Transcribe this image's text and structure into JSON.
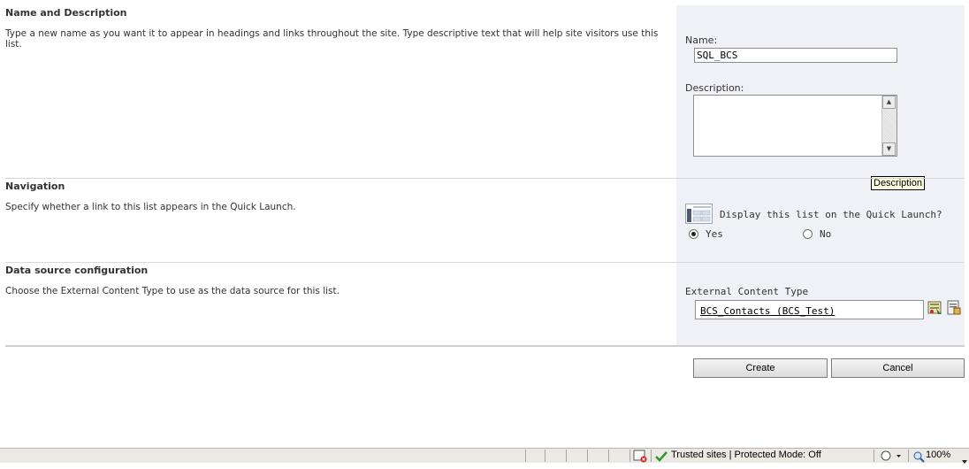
{
  "sections": {
    "name_desc": {
      "title": "Name and Description",
      "description": "Type a new name as you want it to appear in headings and links throughout the site. Type descriptive text that will help site visitors use this list."
    },
    "navigation": {
      "title": "Navigation",
      "description": "Specify whether a link to this list appears in the Quick Launch."
    },
    "data_source": {
      "title": "Data source configuration",
      "description": "Choose the External Content Type to use as the data source for this list."
    }
  },
  "form": {
    "name_label": "Name:",
    "name_value": "SQL_BCS",
    "description_label": "Description:",
    "description_value": "",
    "tooltip": "Description",
    "quick_launch_question": "Display this list on the Quick Launch?",
    "yes_label": "Yes",
    "no_label": "No",
    "yes_selected": true,
    "ect_label": "External Content Type",
    "ect_value": "BCS_Contacts (BCS_Test)"
  },
  "buttons": {
    "create": "Create",
    "cancel": "Cancel"
  },
  "statusbar": {
    "zone": "Trusted sites | Protected Mode: Off",
    "zoom": "100%"
  },
  "icons": {
    "quick_launch": "quick-launch-icon",
    "browse": "select-entity-icon",
    "ect_picker": "external-content-type-picker-icon"
  }
}
